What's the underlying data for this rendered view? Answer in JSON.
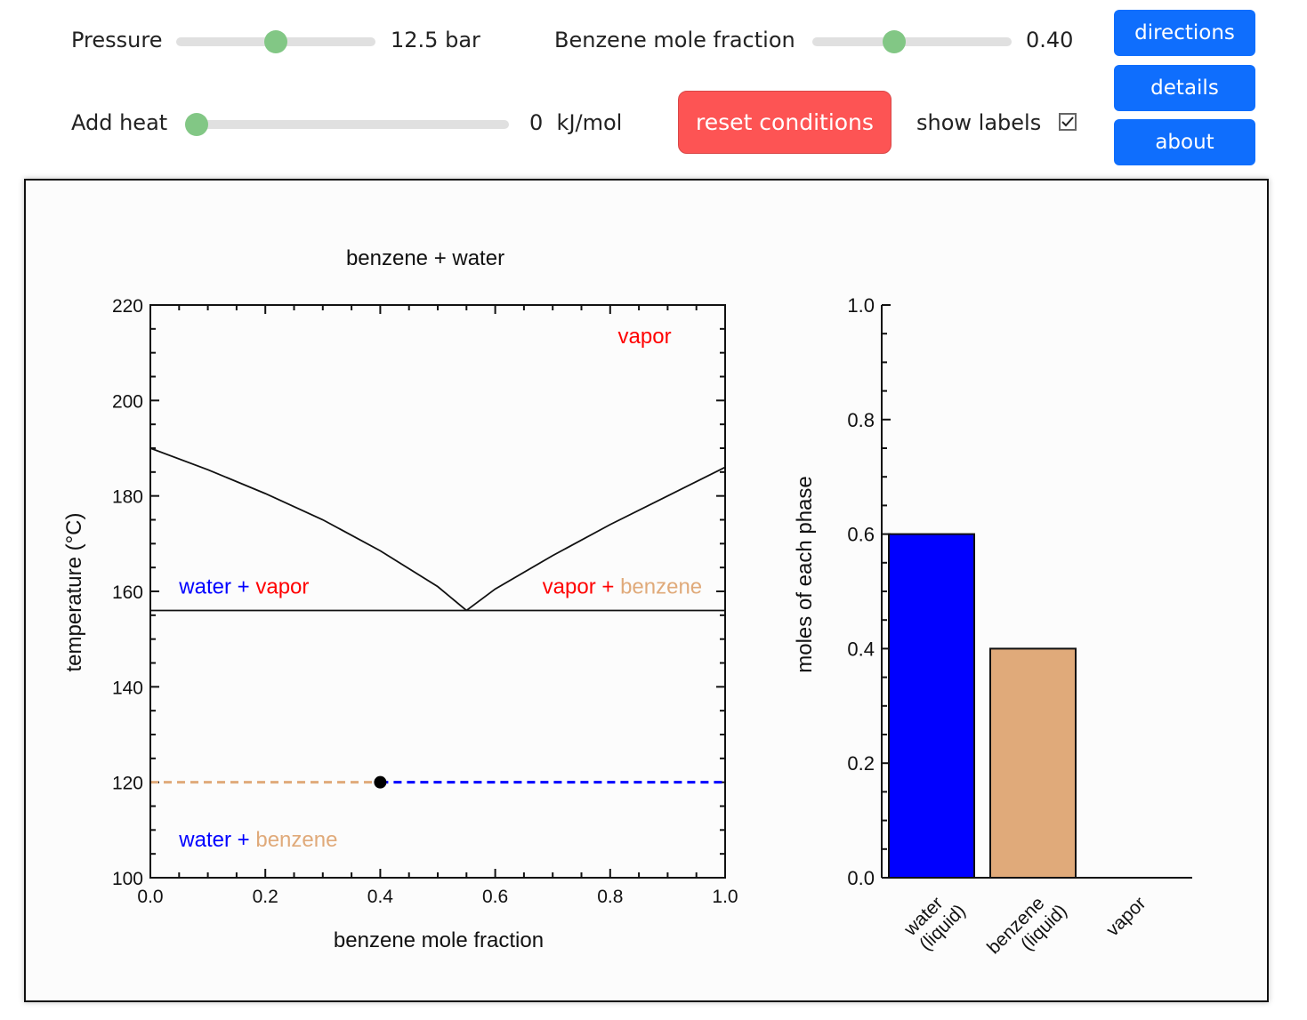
{
  "controls": {
    "pressure": {
      "label": "Pressure",
      "value": "12.5",
      "unit": "bar",
      "fraction": 0.5
    },
    "benzene": {
      "label": "Benzene mole fraction",
      "value": "0.40",
      "fraction": 0.4
    },
    "heat": {
      "label": "Add heat",
      "value": "0",
      "unit": "kJ/mol",
      "fraction": 0.0
    },
    "reset_label": "reset conditions",
    "show_labels": {
      "label": "show labels",
      "checked": true
    },
    "buttons": {
      "directions": "directions",
      "details": "details",
      "about": "about"
    }
  },
  "colors": {
    "water": "#0000ff",
    "benzene": "#e0aa7a",
    "vapor": "#ff0000",
    "slider_thumb": "#82c785",
    "button_blue": "#0f6efd",
    "button_reset": "#fd5454"
  },
  "chart_data": [
    {
      "type": "line",
      "title": "benzene + water",
      "xlabel": "benzene mole fraction",
      "ylabel": "temperature (°C)",
      "xlim": [
        0.0,
        1.0
      ],
      "ylim": [
        100,
        220
      ],
      "xticks": [
        "0.0",
        "0.2",
        "0.4",
        "0.6",
        "0.8",
        "1.0"
      ],
      "yticks": [
        "100",
        "120",
        "140",
        "160",
        "180",
        "200",
        "220"
      ],
      "series": [
        {
          "name": "water dew curve",
          "x": [
            0.0,
            0.1,
            0.2,
            0.3,
            0.4,
            0.5,
            0.55
          ],
          "y": [
            190,
            185.5,
            180.5,
            175,
            168.5,
            161,
            156
          ]
        },
        {
          "name": "benzene dew curve",
          "x": [
            0.55,
            0.6,
            0.7,
            0.8,
            0.9,
            1.0
          ],
          "y": [
            156,
            160.5,
            167.5,
            174,
            180,
            186
          ]
        },
        {
          "name": "three-phase line",
          "x": [
            0.0,
            1.0
          ],
          "y": [
            156,
            156
          ]
        }
      ],
      "tie_line": {
        "temperature": 120,
        "left_color": "benzene",
        "right_color": "water",
        "x_range": [
          0.0,
          1.0
        ]
      },
      "state_point": {
        "x": 0.4,
        "y": 120
      },
      "region_labels": [
        {
          "parts": [
            {
              "text": "vapor",
              "color": "vapor"
            }
          ]
        },
        {
          "parts": [
            {
              "text": "water",
              "color": "water"
            },
            {
              "text": " + ",
              "color": "water"
            },
            {
              "text": "vapor",
              "color": "vapor"
            }
          ]
        },
        {
          "parts": [
            {
              "text": "vapor",
              "color": "vapor"
            },
            {
              "text": " + ",
              "color": "vapor"
            },
            {
              "text": "benzene",
              "color": "benzene"
            }
          ]
        },
        {
          "parts": [
            {
              "text": "water",
              "color": "water"
            },
            {
              "text": " + ",
              "color": "water"
            },
            {
              "text": "benzene",
              "color": "benzene"
            }
          ]
        }
      ]
    },
    {
      "type": "bar",
      "ylabel": "moles of each phase",
      "ylim": [
        0.0,
        1.0
      ],
      "yticks": [
        "0.0",
        "0.2",
        "0.4",
        "0.6",
        "0.8",
        "1.0"
      ],
      "categories": [
        [
          "water",
          "(liquid)"
        ],
        [
          "benzene",
          "(liquid)"
        ],
        [
          "vapor"
        ]
      ],
      "values": [
        0.6,
        0.4,
        0.0
      ],
      "bar_colors": [
        "water",
        "benzene",
        "vapor"
      ]
    }
  ]
}
